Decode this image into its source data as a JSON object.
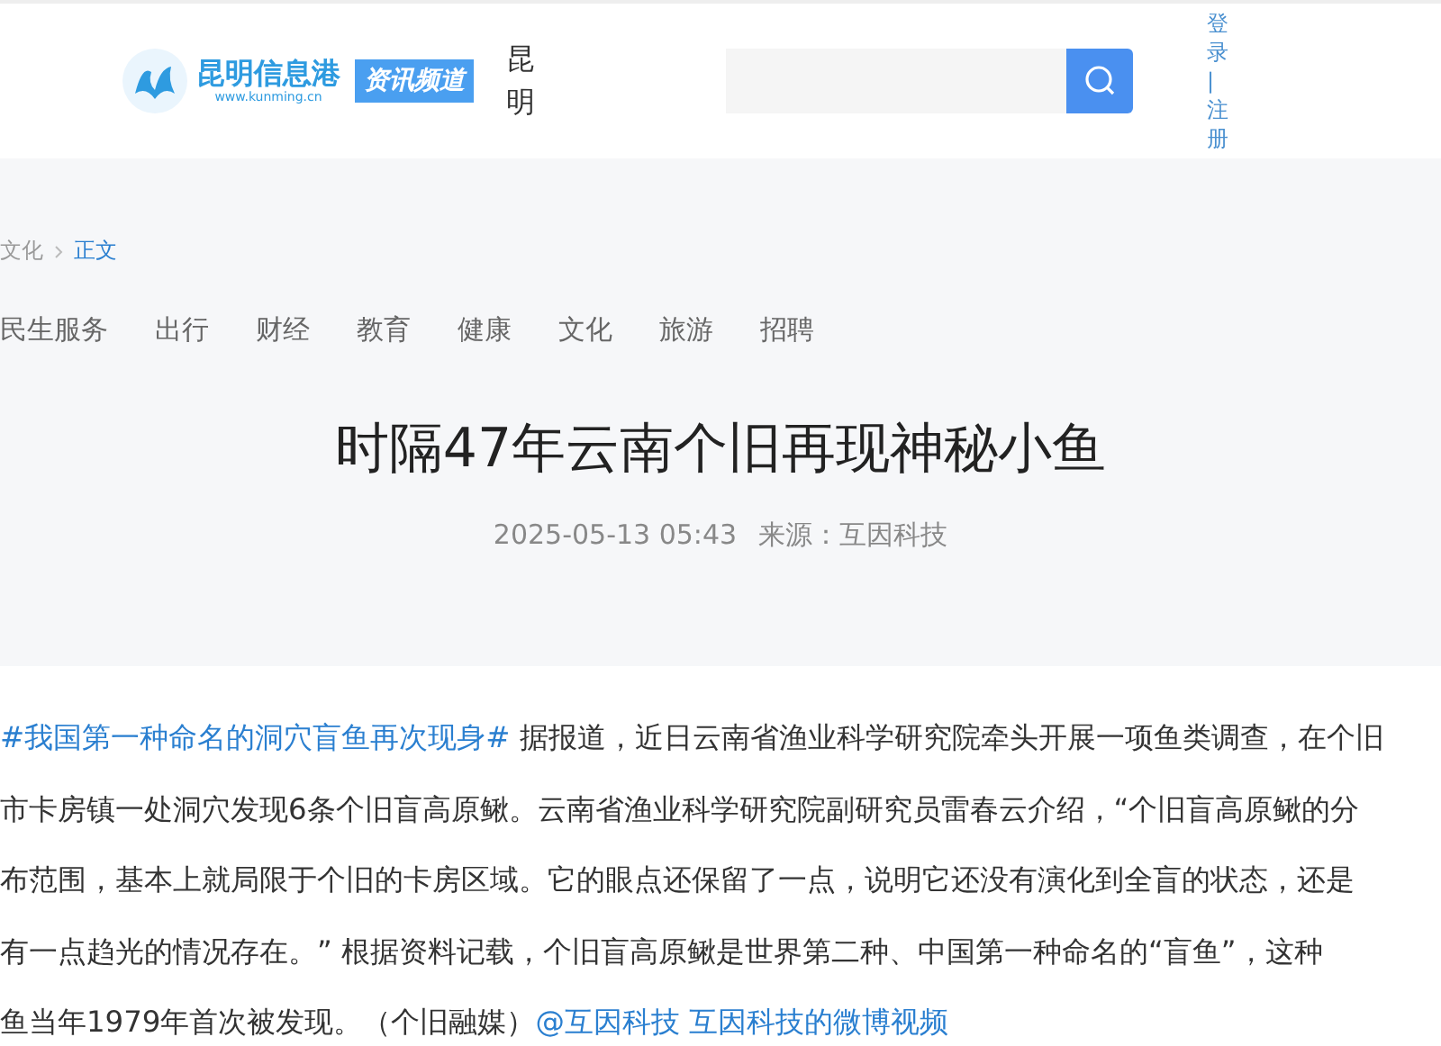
{
  "header": {
    "logo_name": "昆明信息港",
    "logo_url": "www.kunming.cn",
    "channel_badge": "资讯频道",
    "city": "昆明",
    "login": "登录",
    "separator": "|",
    "register": "注册"
  },
  "breadcrumb": [
    {
      "label": "文化",
      "selected": false
    },
    {
      "label": "正文",
      "selected": true
    }
  ],
  "nav": [
    {
      "label": "民生服务"
    },
    {
      "label": "出行"
    },
    {
      "label": "财经"
    },
    {
      "label": "教育"
    },
    {
      "label": "健康"
    },
    {
      "label": "文化"
    },
    {
      "label": "旅游"
    },
    {
      "label": "招聘"
    }
  ],
  "article": {
    "title": "时隔47年云南个旧再现神秘小鱼",
    "date": "2025-05-13 05:43",
    "source": "来源：互因科技",
    "lines": [
      {
        "parts": [
          {
            "kind": "link",
            "text": "#我国第一种命名的洞穴盲鱼再次现身#"
          },
          {
            "kind": "text",
            "text": " 据报道，近日云南省渔业科学研究院牵头开展一项鱼类调查，在个旧"
          }
        ]
      },
      {
        "parts": [
          {
            "kind": "text",
            "text": "市卡房镇一处洞穴发现6条个旧盲高原鳅。云南省渔业科学研究院副研究员雷春云介绍，“个旧盲高原鳅的分"
          }
        ]
      },
      {
        "parts": [
          {
            "kind": "text",
            "text": "布范围，基本上就局限于个旧的卡房区域。它的眼点还保留了一点，说明它还没有演化到全盲的状态，还是"
          }
        ]
      },
      {
        "parts": [
          {
            "kind": "text",
            "text": "有一点趋光的情况存在。” 根据资料记载，个旧盲高原鳅是世界第二种、中国第一种命名的“盲鱼”，这种"
          }
        ]
      },
      {
        "parts": [
          {
            "kind": "text",
            "text": "鱼当年1979年首次被发现。（个旧融媒）"
          },
          {
            "kind": "link",
            "text": "@互因科技"
          },
          {
            "kind": "link",
            "text": " 互因科技的微博视频"
          }
        ]
      }
    ]
  }
}
